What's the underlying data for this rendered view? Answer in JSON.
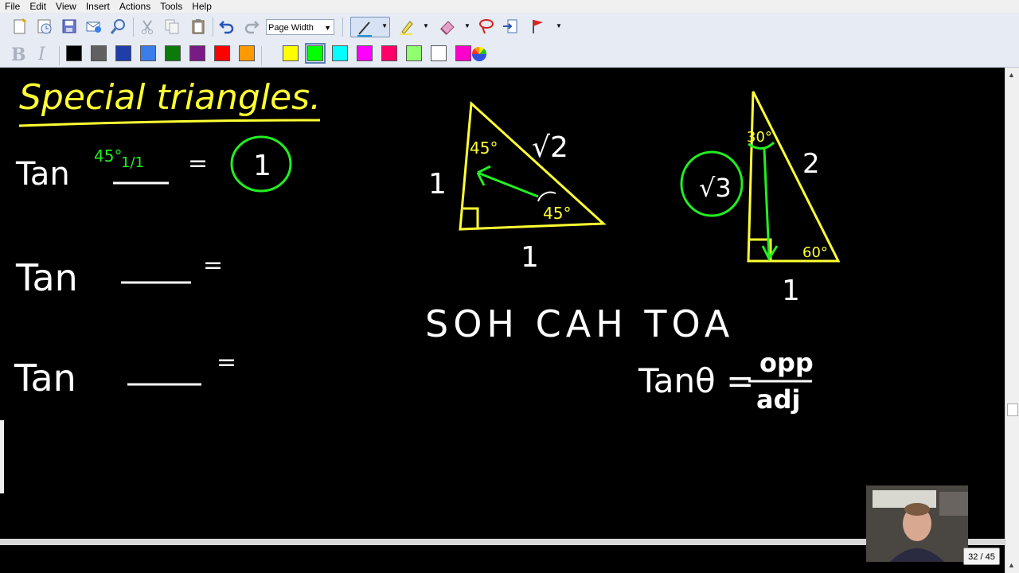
{
  "menu": [
    "File",
    "Edit",
    "View",
    "Insert",
    "Actions",
    "Tools",
    "Help"
  ],
  "toolbar": {
    "zoom_value": "Page Width",
    "icons": [
      "new-page-icon",
      "clock-icon",
      "save-icon",
      "email-icon",
      "zoom-icon",
      "cut-icon",
      "copy-icon",
      "paste-icon",
      "undo-icon",
      "redo-icon",
      "pen-icon",
      "highlighter-icon",
      "eraser-icon",
      "lasso-icon",
      "insert-space-icon",
      "flag-icon"
    ]
  },
  "format": {
    "bold": "B",
    "italic": "I",
    "swatches": [
      "#000000",
      "#606060",
      "#1f3ea8",
      "#3b7dea",
      "#0b7a0b",
      "#7a1a86",
      "#ff0000",
      "#ff9900",
      "#ffff00",
      "#00ff00",
      "#00ffff",
      "#ff00ff",
      "#ff0066",
      "#90ff70",
      "#ffffff",
      "#ff00cc"
    ],
    "selected_swatch_index": 9
  },
  "canvas": {
    "title": "Special triangles.",
    "row1": "Tan",
    "row1_angle": "45°",
    "row1_ratio": "1/1",
    "row1_equals": "=",
    "row1_answer": "1",
    "row2": "Tan",
    "row2_equals": "=",
    "row3": "Tan",
    "row3_equals": "=",
    "tri1_hyp": "√2",
    "tri1_leg_left": "1",
    "tri1_leg_bottom": "1",
    "tri1_angle_top": "45°",
    "tri1_angle_right": "45°",
    "tri2_hyp": "2",
    "tri2_bottom": "1",
    "tri2_angle_top": "30°",
    "tri2_angle_bottom": "60°",
    "tri2_circled": "√3",
    "mnemonic": "SOH CAH TOA",
    "formula_left": "Tanθ =",
    "formula_num": "opp",
    "formula_den": "adj"
  },
  "page_indicator": "32 / 45",
  "colors": {
    "ink_white": "#ffffff",
    "ink_yellow": "#ffff33",
    "ink_green": "#22ee22"
  }
}
